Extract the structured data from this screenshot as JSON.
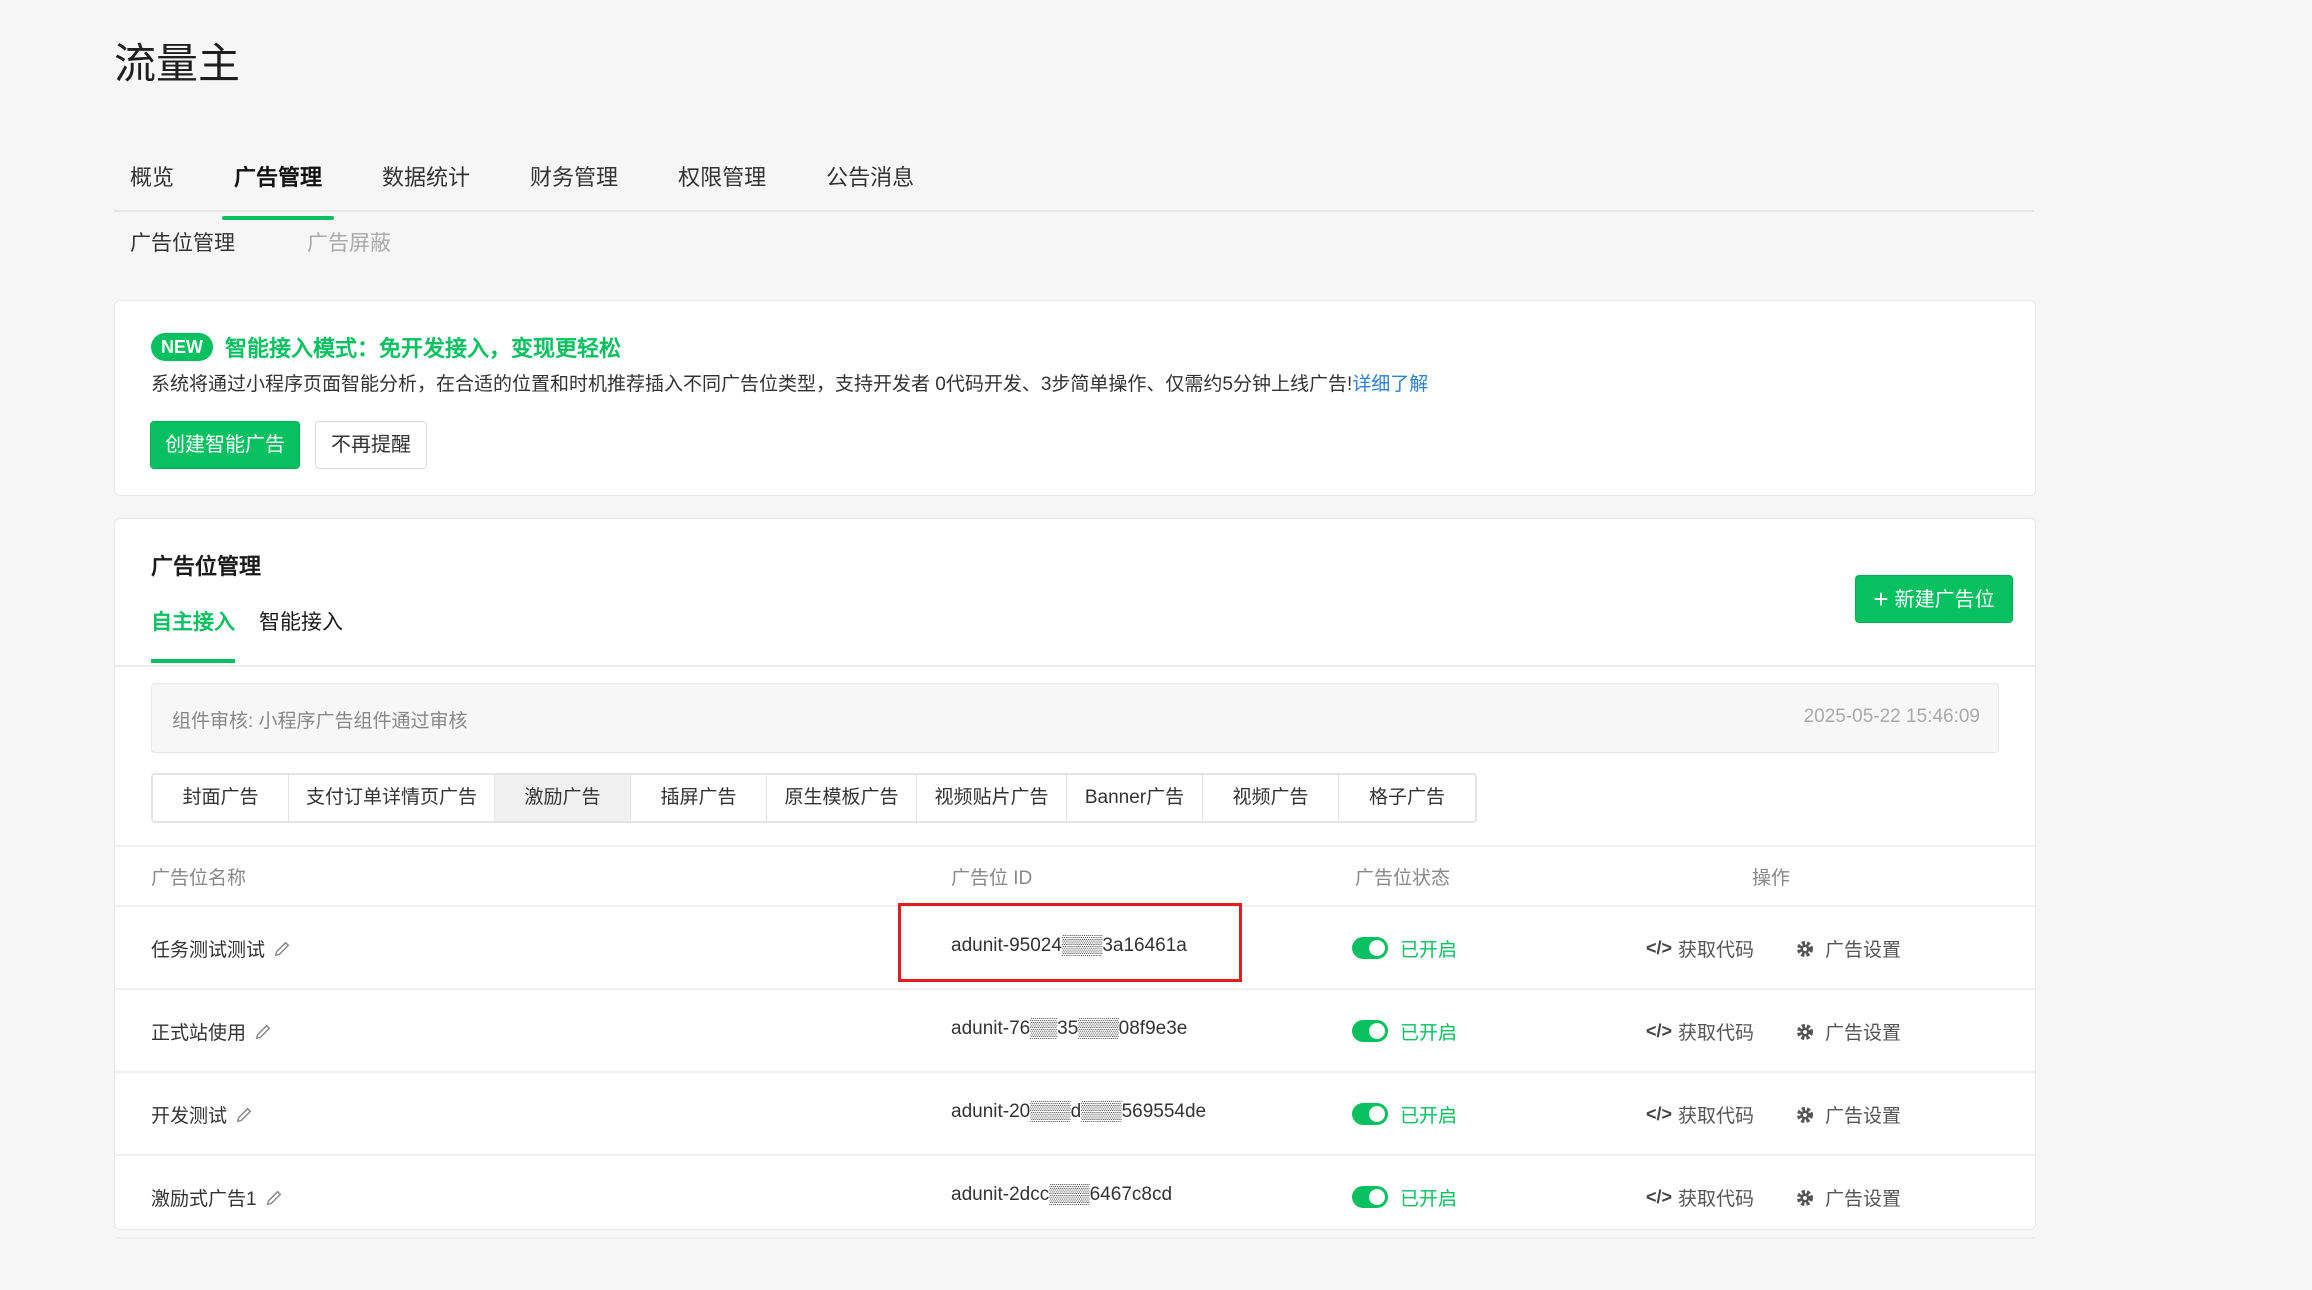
{
  "app": {
    "title": "流量主"
  },
  "main_nav": {
    "tabs": [
      {
        "label": "概览",
        "active": false
      },
      {
        "label": "广告管理",
        "active": true
      },
      {
        "label": "数据统计",
        "active": false
      },
      {
        "label": "财务管理",
        "active": false
      },
      {
        "label": "权限管理",
        "active": false
      },
      {
        "label": "公告消息",
        "active": false
      }
    ]
  },
  "sub_nav": {
    "items": [
      {
        "label": "广告位管理",
        "state": "active"
      },
      {
        "label": "广告屏蔽",
        "state": "disabled"
      }
    ]
  },
  "promo": {
    "badge": "NEW",
    "title": "智能接入模式：免开发接入，变现更轻松",
    "description": "系统将通过小程序页面智能分析，在合适的位置和时机推荐插入不同广告位类型，支持开发者 0代码开发、3步简单操作、仅需约5分钟上线广告!",
    "link": "详细了解",
    "create_button": "创建智能广告",
    "dismiss_button": "不再提醒"
  },
  "manage": {
    "title": "广告位管理",
    "tabs": [
      {
        "label": "自主接入",
        "active": true
      },
      {
        "label": "智能接入",
        "active": false
      }
    ],
    "new_button": "新建广告位",
    "review": {
      "text": "组件审核: 小程序广告组件通过审核",
      "time": "2025-05-22 15:46:09"
    },
    "ad_types": [
      {
        "label": "封面广告",
        "active": false
      },
      {
        "label": "支付订单详情页广告",
        "active": false
      },
      {
        "label": "激励广告",
        "active": true
      },
      {
        "label": "插屏广告",
        "active": false
      },
      {
        "label": "原生模板广告",
        "active": false
      },
      {
        "label": "视频贴片广告",
        "active": false
      },
      {
        "label": "Banner广告",
        "active": false
      },
      {
        "label": "视频广告",
        "active": false
      },
      {
        "label": "格子广告",
        "active": false
      }
    ],
    "table": {
      "headers": {
        "name": "广告位名称",
        "id": "广告位 ID",
        "status": "广告位状态",
        "ops": "操作"
      },
      "rows": [
        {
          "name": "任务测试测试",
          "id": "adunit-95024▒▒▒3a16461a",
          "status": "已开启",
          "get_code": "获取代码",
          "settings": "广告设置"
        },
        {
          "name": "正式站使用",
          "id": "adunit-76▒▒35▒▒▒08f9e3e",
          "status": "已开启",
          "get_code": "获取代码",
          "settings": "广告设置"
        },
        {
          "name": "开发测试",
          "id": "adunit-20▒▒▒d▒▒▒569554de",
          "status": "已开启",
          "get_code": "获取代码",
          "settings": "广告设置"
        },
        {
          "name": "激励式广告1",
          "id": "adunit-2dcc▒▒▒6467c8cd",
          "status": "已开启",
          "get_code": "获取代码",
          "settings": "广告设置"
        }
      ]
    }
  },
  "colors": {
    "accent": "#07c160",
    "link": "#2d7fd8",
    "highlight_box": "#e02020"
  },
  "icons": {
    "edit": "pencil-icon",
    "code": "code-icon",
    "settings": "gear-icon",
    "add": "plus-icon",
    "toggle": "toggle-switch-icon"
  }
}
